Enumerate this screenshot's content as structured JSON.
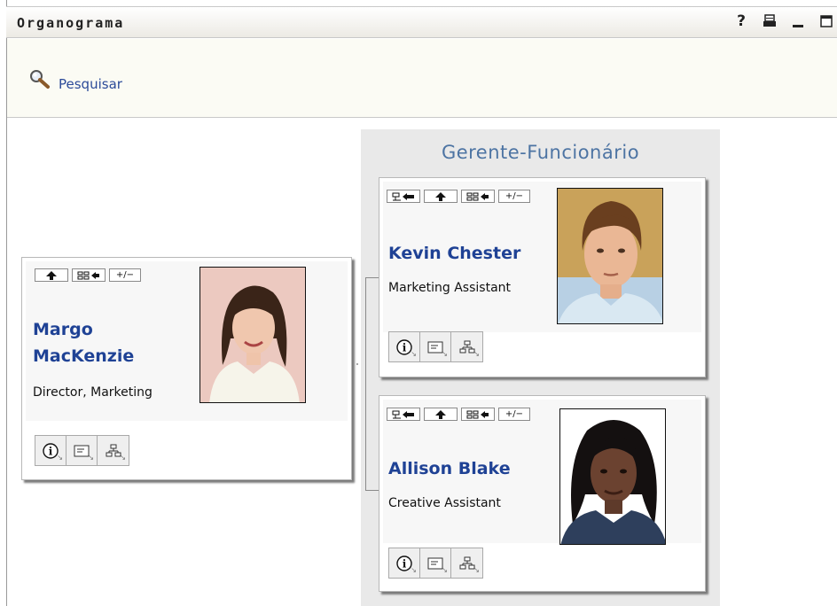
{
  "window": {
    "title": "Organograma",
    "help_icon": "?",
    "print_icon": "printer-icon",
    "minimize_icon": "_",
    "maximize_icon": "maximize-icon"
  },
  "toolbar": {
    "search_label": "Pesquisar"
  },
  "nav_buttons": {
    "to_root": "root-icon",
    "up": "up-arrow-icon",
    "expand": "expand-org-icon",
    "toggle": "+/−"
  },
  "focus_person": {
    "name_line1": "Margo",
    "name_line2": "MacKenzie",
    "title": "Director, Marketing"
  },
  "manager_panel": {
    "title": "Gerente-Funcionário",
    "reports": [
      {
        "name": "Kevin Chester",
        "title": "Marketing Assistant"
      },
      {
        "name": "Allison Blake",
        "title": "Creative Assistant"
      }
    ]
  },
  "action_buttons": [
    "info-icon",
    "email-card-icon",
    "org-chart-icon"
  ],
  "colors": {
    "name_link": "#1f4295",
    "panel_title": "#4d74a3",
    "search_link": "#2b4a99"
  }
}
